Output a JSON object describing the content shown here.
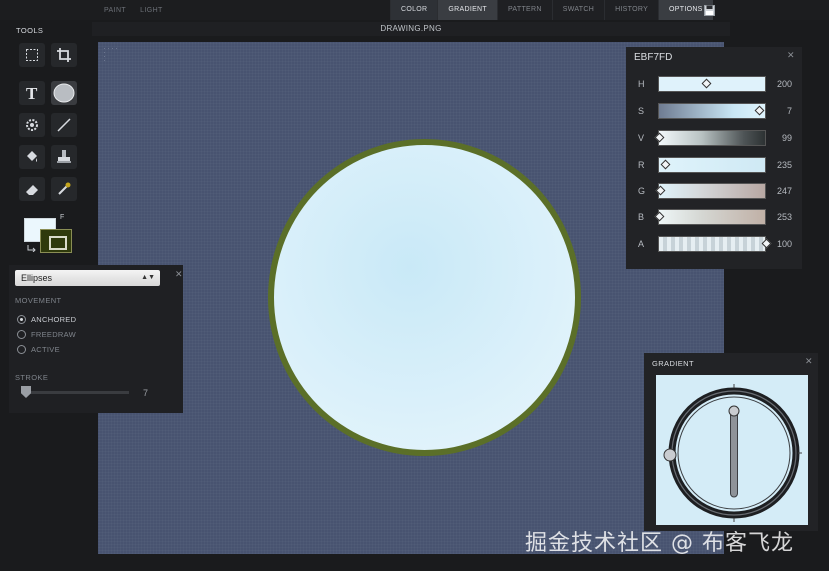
{
  "menu": {
    "paint": "PAINT",
    "light": "LIGHT"
  },
  "tabs": [
    {
      "label": "COLOR"
    },
    {
      "label": "GRADIENT"
    },
    {
      "label": "PATTERN"
    },
    {
      "label": "SWATCH"
    },
    {
      "label": "HISTORY"
    },
    {
      "label": "OPTIONS"
    }
  ],
  "icons": {
    "save": "floppy-disk-icon"
  },
  "tools": {
    "title": "TOOLS",
    "items": [
      "marquee",
      "crop",
      "text",
      "ellipse",
      "shape",
      "line",
      "bucket",
      "stamp",
      "eraser",
      "eyedropper"
    ],
    "swatch_label": "F",
    "foreground_color": "#2f3a0c",
    "background_color": "#EBF7FD"
  },
  "document": {
    "title": "DRAWING.PNG",
    "canvas_color": "#485370",
    "ellipse_fill": "#EBF7FD",
    "ellipse_stroke": "#5b6f28"
  },
  "ellipse_options": {
    "shape": "Ellipses",
    "movement_label": "MOVEMENT",
    "movement_options": [
      "ANCHORED",
      "FREEDRAW",
      "ACTIVE"
    ],
    "selected": "ANCHORED",
    "stroke_label": "STROKE",
    "stroke_value": "7"
  },
  "color": {
    "hex": "EBF7FD",
    "channels": [
      {
        "name": "H",
        "value": "200"
      },
      {
        "name": "S",
        "value": "7"
      },
      {
        "name": "V",
        "value": "99"
      },
      {
        "name": "R",
        "value": "235"
      },
      {
        "name": "G",
        "value": "247"
      },
      {
        "name": "B",
        "value": "253"
      },
      {
        "name": "A",
        "value": "100"
      }
    ]
  },
  "gradient": {
    "title": "GRADIENT"
  },
  "watermark": "掘金技术社区 @ 布客飞龙"
}
